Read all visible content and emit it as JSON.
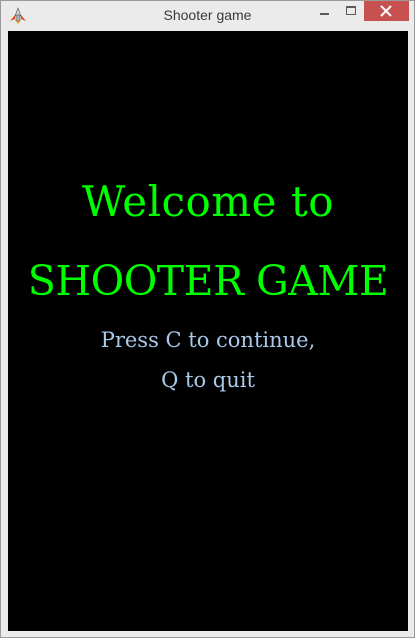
{
  "window": {
    "title": "Shooter game",
    "icon": "spaceship-icon"
  },
  "title_buttons": {
    "minimize": "minimize-icon",
    "maximize": "maximize-icon",
    "close": "close-icon",
    "close_color": "#c75050"
  },
  "screen": {
    "background": "#000000",
    "welcome_line": "Welcome to",
    "game_title": "SHOOTER GAME",
    "title_color": "#00ff00",
    "prompt_line1": "Press C to continue,",
    "prompt_line2": "Q to quit",
    "prompt_color": "#a9c9e9"
  }
}
